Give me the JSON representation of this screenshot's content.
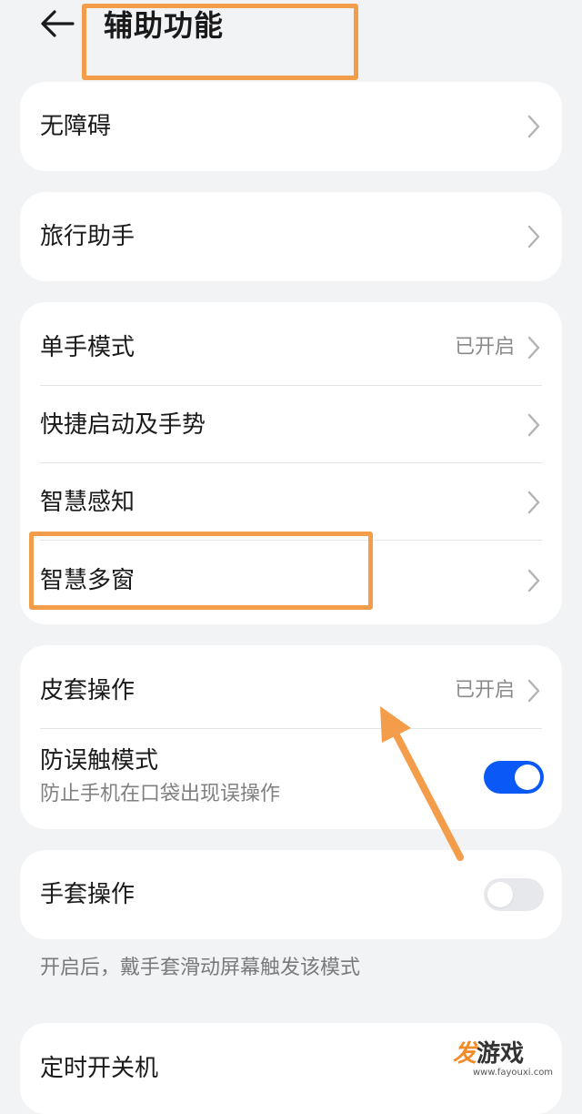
{
  "header": {
    "title": "辅助功能",
    "back_icon": "arrow-left-icon"
  },
  "groups": {
    "accessibility": {
      "label": "无障碍"
    },
    "travel": {
      "label": "旅行助手"
    },
    "gestures": {
      "one_hand": {
        "label": "单手模式",
        "value": "已开启"
      },
      "shortcuts": {
        "label": "快捷启动及手势"
      },
      "smart_sense": {
        "label": "智慧感知"
      },
      "multi_window": {
        "label": "智慧多窗"
      }
    },
    "cover": {
      "cover_ops": {
        "label": "皮套操作",
        "value": "已开启"
      },
      "pocket_mode": {
        "label": "防误触模式",
        "subtitle": "防止手机在口袋出现误操作",
        "enabled": true
      }
    },
    "glove": {
      "glove_mode": {
        "label": "手套操作",
        "enabled": false
      },
      "footnote": "开启后，戴手套滑动屏幕触发该模式"
    },
    "schedule": {
      "power_schedule": {
        "label": "定时开关机"
      }
    }
  },
  "watermark": {
    "logo_char": "发",
    "logo_text": "游戏",
    "url": "www.fayouxi.com"
  },
  "colors": {
    "background": "#f1f3f5",
    "card": "#ffffff",
    "accent": "#0a59f7",
    "annotation": "#f39c4a",
    "text_primary": "#1a1a1a",
    "text_secondary": "#808080"
  },
  "icons": {
    "chevron": "chevron-right-icon",
    "back": "arrow-left-icon"
  }
}
